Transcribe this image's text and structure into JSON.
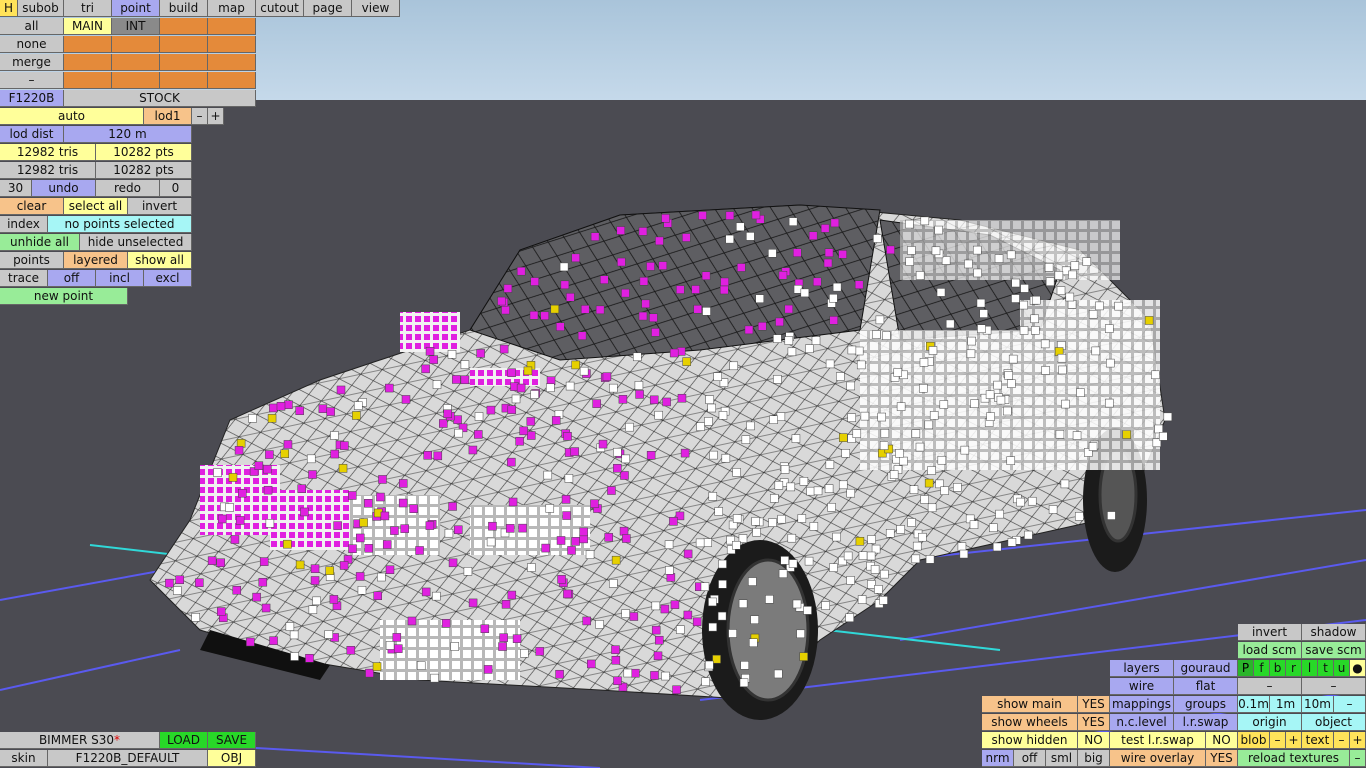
{
  "menu": {
    "h": "H",
    "items": [
      "subob",
      "tri",
      "point",
      "build",
      "map",
      "cutout",
      "page",
      "view"
    ],
    "active": "point"
  },
  "selection": {
    "all": "all",
    "none": "none",
    "merge": "merge",
    "dash": "–",
    "layer_tabs": [
      "MAIN",
      "INT"
    ]
  },
  "model": {
    "code": "F1220B",
    "variant": "STOCK"
  },
  "lod": {
    "auto": "auto",
    "name": "lod1",
    "minus": "–",
    "plus": "+",
    "dist_label": "lod dist",
    "dist_value": "120 m"
  },
  "stats": {
    "tris1": "12982 tris",
    "pts1": "10282 pts",
    "tris2": "12982 tris",
    "pts2": "10282 pts"
  },
  "history": {
    "count": "30",
    "undo": "undo",
    "redo": "redo",
    "redo_count": "0"
  },
  "tools": {
    "clear": "clear",
    "select_all": "select all",
    "invert": "invert",
    "index": "index",
    "no_points": "no points selected",
    "unhide_all": "unhide all",
    "hide_unselected": "hide unselected",
    "points": "points",
    "layered": "layered",
    "show_all": "show all",
    "trace": "trace",
    "off": "off",
    "incl": "incl",
    "excl": "excl",
    "new_point": "new point"
  },
  "footer": {
    "car_name": "BIMMER S30",
    "modified": "*",
    "load": "LOAD",
    "save": "SAVE",
    "skin_label": "skin",
    "skin_value": "F1220B_DEFAULT",
    "obj": "OBJ"
  },
  "right_panel": {
    "invert": "invert",
    "shadow": "shadow",
    "load_scm": "load scm",
    "save_scm": "save scm",
    "layers": "layers",
    "gouraud": "gouraud",
    "flags": [
      "P",
      "f",
      "b",
      "r",
      "l",
      "t",
      "u",
      "●"
    ],
    "wire": "wire",
    "flat": "flat",
    "dash": "–",
    "mappings": "mappings",
    "groups": "groups",
    "scale": [
      "0.1m",
      "1m",
      "10m",
      "–"
    ],
    "nc_level": "n.c.level",
    "lr_swap": "l.r.swap",
    "origin": "origin",
    "object": "object",
    "test_lr_swap": "test l.r.swap",
    "no": "NO",
    "blob": "blob",
    "text": "text",
    "minus": "–",
    "plus": "+",
    "wire_overlay": "wire overlay",
    "yes": "YES",
    "reload_textures": "reload textures",
    "show_main": "show main",
    "show_wheels": "show wheels",
    "show_hidden": "show hidden",
    "show_main_val": "YES",
    "show_wheels_val": "YES",
    "show_hidden_val": "NO",
    "nrm": "nrm",
    "off": "off",
    "sml": "sml",
    "big": "big"
  },
  "colors": {
    "sky": "#b9d3e6",
    "ground": "#4b4b52",
    "selected_point": "#e020e0",
    "point": "#ffffff",
    "yellow_point": "#e6d000"
  }
}
